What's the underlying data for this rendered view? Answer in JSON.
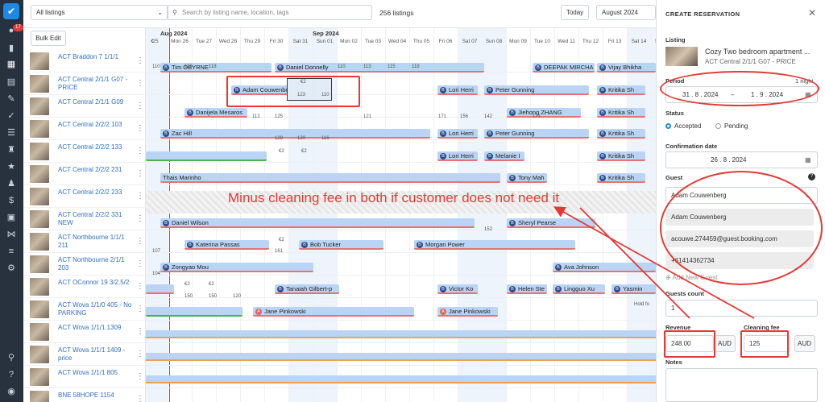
{
  "topbar": {
    "listing_filter": "All listings",
    "search_placeholder": "Search by listing name, location, tags",
    "listing_count": "256 listings",
    "today_label": "Today",
    "month_label": "August 2024",
    "bulk_edit": "Bulk Edit"
  },
  "rail": {
    "notification_count": "17"
  },
  "calendar": {
    "months": [
      "Aug 2024",
      "Sep 2024"
    ],
    "days": [
      "25",
      "Mon 26",
      "Tue 27",
      "Wed 28",
      "Thu 29",
      "Fri 30",
      "Sat 31",
      "Sun 01",
      "Mon 02",
      "Tue 03",
      "Wed 04",
      "Thu 05",
      "Fri 06",
      "Sat 07",
      "Sun 08",
      "Mon 09",
      "Tue 10",
      "Wed 11",
      "Thu 12",
      "Fri 13",
      "Sat 14",
      "Sun 15"
    ],
    "listings": [
      "ACT Braddon 7 1/1/1",
      "ACT Central 2/1/1 G07 - PRICE",
      "ACT Central 2/1/1 G09",
      "ACT Central 2/2/2 103",
      "ACT Central 2/2/2 133",
      "ACT Central 2/2/2 231",
      "ACT Central 2/2/2 233",
      "ACT Central 2/2/2 331 NEW",
      "ACT Northbourne 1/1/1 211",
      "ACT Northbourne 2/1/1 203",
      "ACT OConnor 19 3/2.5/2",
      "ACT Wova 1/1/0 405 - No PARKING",
      "ACT Wova 1/1/1 1309",
      "ACT Wova 1/1/1 1409 - price",
      "ACT Wova 1/1/1 805",
      "BNE 58HOPE 1154"
    ],
    "guests": {
      "tim": "Tim OBYRNE",
      "daniel_d": "Daniel Donnelly",
      "deepak": "DEEPAK MIRCHA",
      "vijay": "Vijay Bhikha",
      "adam": "Adam Couwenbe",
      "lori": "Lori Herri",
      "peter": "Peter Gunning",
      "kritika": "Kritika Sh",
      "danijela": "Danijela Mesaros",
      "jiehong": "Jiehong ZHANG",
      "zac": "Zac Hill",
      "melanie": "Melanie I",
      "thais": "Thais Marinho",
      "tony": "Tony Mah",
      "daniel_w": "Daniel Wilson",
      "sheryl": "Sheryl Pearse",
      "katerina": "Katerina Passas",
      "bob": "Bob Tucker",
      "morgan": "Morgan Power",
      "zongyao": "Zongyao Mou",
      "ava": "Ava Johnson",
      "tanaiah": "Tanaiah Gilbert-p",
      "victor": "Victor Ko",
      "helen": "Helen Ste",
      "lingguo": "Lingguo Xu",
      "yasmin": "Yasmin",
      "jane": "Jane Pinkowski",
      "hold": "Hold fo"
    },
    "prices": {
      "p110": "110",
      "p112": "112",
      "p118": "118",
      "p123": "123",
      "p125": "125",
      "p129": "129",
      "p130": "130",
      "p113": "113",
      "p115": "115",
      "p116": "116",
      "p121": "121",
      "p171": "171",
      "p156": "156",
      "p142": "142",
      "p161": "161",
      "p152": "152",
      "p150": "150",
      "p120": "120",
      "p104": "104",
      "p107": "107",
      "e2": "€2"
    }
  },
  "annotation": "Minus cleaning fee in both if customer does not need it",
  "panel": {
    "title": "CREATE RESERVATION",
    "listing_label": "Listing",
    "listing_name": "Cozy Two bedroom apartment ...",
    "listing_sub": "ACT Central 2/1/1 G07 - PRICE",
    "period_label": "Period",
    "nights": "1 night",
    "period_start": "31 . 8 . 2024",
    "period_sep": "–",
    "period_end": "1 . 9 . 2024",
    "status_label": "Status",
    "status_accepted": "Accepted",
    "status_pending": "Pending",
    "confirmation_label": "Confirmation date",
    "confirmation_value": "26 . 8 . 2024",
    "guest_label": "Guest",
    "guest_select": "Adam Couwenberg",
    "guest_name": "Adam Couwenberg",
    "guest_email": "acouwe.274459@guest.booking.com",
    "guest_phone": "+61414362734",
    "add_guest": "Add New Guest",
    "guests_count_label": "Guests count",
    "guests_count": "1",
    "revenue_label": "Revenue",
    "revenue_value": "248.00",
    "revenue_currency": "AUD",
    "cleaning_label": "Cleaning fee",
    "cleaning_value": "125",
    "cleaning_currency": "AUD",
    "notes_label": "Notes"
  }
}
